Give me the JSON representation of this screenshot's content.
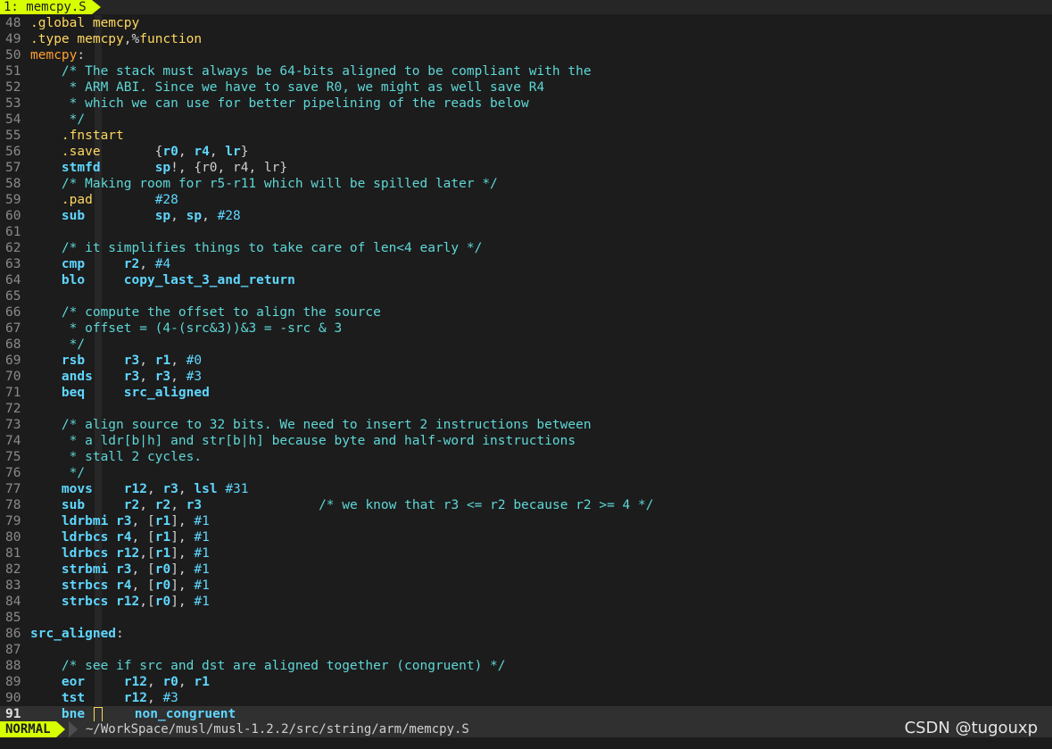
{
  "tabline": {
    "tab_label": "1: memcpy.S"
  },
  "statusline": {
    "mode": "NORMAL",
    "path": "~/WorkSpace/musl/musl-1.2.2/src/string/arm/memcpy.S"
  },
  "watermark": "CSDN @tugouxp",
  "colors": {
    "accent": "#d7ff00",
    "background": "#1c1c1c",
    "comment": "#5fd7d7",
    "label": "#ff9f2f",
    "keyword": "#5fd7ff",
    "directive": "#ffd75f"
  },
  "cursor_line": "91",
  "lines": [
    {
      "n": "48",
      "tokens": [
        [
          "directive",
          ".global "
        ],
        [
          "ident",
          "memcpy"
        ]
      ]
    },
    {
      "n": "49",
      "tokens": [
        [
          "directive",
          ".type "
        ],
        [
          "ident",
          "memcpy"
        ],
        [
          "plain",
          ",%"
        ],
        [
          "ident",
          "function"
        ]
      ]
    },
    {
      "n": "50",
      "tokens": [
        [
          "label",
          "memcpy"
        ],
        [
          "plain",
          ":"
        ]
      ]
    },
    {
      "n": "51",
      "tokens": [
        [
          "plain",
          "    "
        ],
        [
          "comment",
          "/* The stack must always be 64-bits aligned to be compliant with the"
        ]
      ]
    },
    {
      "n": "52",
      "tokens": [
        [
          "plain",
          "     "
        ],
        [
          "comment",
          "* ARM ABI. Since we have to save R0, we might as well save R4"
        ]
      ]
    },
    {
      "n": "53",
      "tokens": [
        [
          "plain",
          "     "
        ],
        [
          "comment",
          "* which we can use for better pipelining of the reads below"
        ]
      ]
    },
    {
      "n": "54",
      "tokens": [
        [
          "plain",
          "     "
        ],
        [
          "comment",
          "*/"
        ]
      ]
    },
    {
      "n": "55",
      "tokens": [
        [
          "plain",
          "    "
        ],
        [
          "directive",
          ".fnstart"
        ]
      ]
    },
    {
      "n": "56",
      "tokens": [
        [
          "plain",
          "    "
        ],
        [
          "directive",
          ".save"
        ],
        [
          "plain",
          "       {"
        ],
        [
          "reg",
          "r0"
        ],
        [
          "plain",
          ", "
        ],
        [
          "reg",
          "r4"
        ],
        [
          "plain",
          ", "
        ],
        [
          "reg",
          "lr"
        ],
        [
          "plain",
          "}"
        ]
      ]
    },
    {
      "n": "57",
      "tokens": [
        [
          "plain",
          "    "
        ],
        [
          "kw",
          "stmfd"
        ],
        [
          "plain",
          "       "
        ],
        [
          "reg",
          "sp"
        ],
        [
          "plain",
          "!, {r0, r4, lr}"
        ]
      ]
    },
    {
      "n": "58",
      "tokens": [
        [
          "plain",
          "    "
        ],
        [
          "comment",
          "/* Making room for r5-r11 which will be spilled later */"
        ]
      ]
    },
    {
      "n": "59",
      "tokens": [
        [
          "plain",
          "    "
        ],
        [
          "directive",
          ".pad"
        ],
        [
          "plain",
          "        "
        ],
        [
          "num",
          "#28"
        ]
      ]
    },
    {
      "n": "60",
      "tokens": [
        [
          "plain",
          "    "
        ],
        [
          "kw",
          "sub"
        ],
        [
          "plain",
          "         "
        ],
        [
          "reg",
          "sp"
        ],
        [
          "plain",
          ", "
        ],
        [
          "reg",
          "sp"
        ],
        [
          "plain",
          ", "
        ],
        [
          "num",
          "#28"
        ]
      ]
    },
    {
      "n": "61",
      "tokens": []
    },
    {
      "n": "62",
      "tokens": [
        [
          "plain",
          "    "
        ],
        [
          "comment",
          "/* it simplifies things to take care of len<4 early */"
        ]
      ]
    },
    {
      "n": "63",
      "tokens": [
        [
          "plain",
          "    "
        ],
        [
          "kw",
          "cmp"
        ],
        [
          "plain",
          "     "
        ],
        [
          "reg",
          "r2"
        ],
        [
          "plain",
          ", "
        ],
        [
          "num",
          "#4"
        ]
      ]
    },
    {
      "n": "64",
      "tokens": [
        [
          "plain",
          "    "
        ],
        [
          "kw",
          "blo"
        ],
        [
          "plain",
          "     "
        ],
        [
          "func",
          "copy_last_3_and_return"
        ]
      ]
    },
    {
      "n": "65",
      "tokens": []
    },
    {
      "n": "66",
      "tokens": [
        [
          "plain",
          "    "
        ],
        [
          "comment",
          "/* compute the offset to align the source"
        ]
      ]
    },
    {
      "n": "67",
      "tokens": [
        [
          "plain",
          "     "
        ],
        [
          "comment",
          "* offset = (4-(src&3))&3 = -src & 3"
        ]
      ]
    },
    {
      "n": "68",
      "tokens": [
        [
          "plain",
          "     "
        ],
        [
          "comment",
          "*/"
        ]
      ]
    },
    {
      "n": "69",
      "tokens": [
        [
          "plain",
          "    "
        ],
        [
          "kw",
          "rsb"
        ],
        [
          "plain",
          "     "
        ],
        [
          "reg",
          "r3"
        ],
        [
          "plain",
          ", "
        ],
        [
          "reg",
          "r1"
        ],
        [
          "plain",
          ", "
        ],
        [
          "num",
          "#0"
        ]
      ]
    },
    {
      "n": "70",
      "tokens": [
        [
          "plain",
          "    "
        ],
        [
          "kw",
          "ands"
        ],
        [
          "plain",
          "    "
        ],
        [
          "reg",
          "r3"
        ],
        [
          "plain",
          ", "
        ],
        [
          "reg",
          "r3"
        ],
        [
          "plain",
          ", "
        ],
        [
          "num",
          "#3"
        ]
      ]
    },
    {
      "n": "71",
      "tokens": [
        [
          "plain",
          "    "
        ],
        [
          "kw",
          "beq"
        ],
        [
          "plain",
          "     "
        ],
        [
          "func",
          "src_aligned"
        ]
      ]
    },
    {
      "n": "72",
      "tokens": []
    },
    {
      "n": "73",
      "tokens": [
        [
          "plain",
          "    "
        ],
        [
          "comment",
          "/* align source to 32 bits. We need to insert 2 instructions between"
        ]
      ]
    },
    {
      "n": "74",
      "tokens": [
        [
          "plain",
          "     "
        ],
        [
          "comment",
          "* a ldr[b|h] and str[b|h] because byte and half-word instructions"
        ]
      ]
    },
    {
      "n": "75",
      "tokens": [
        [
          "plain",
          "     "
        ],
        [
          "comment",
          "* stall 2 cycles."
        ]
      ]
    },
    {
      "n": "76",
      "tokens": [
        [
          "plain",
          "     "
        ],
        [
          "comment",
          "*/"
        ]
      ]
    },
    {
      "n": "77",
      "tokens": [
        [
          "plain",
          "    "
        ],
        [
          "kw",
          "movs"
        ],
        [
          "plain",
          "    "
        ],
        [
          "reg",
          "r12"
        ],
        [
          "plain",
          ", "
        ],
        [
          "reg",
          "r3"
        ],
        [
          "plain",
          ", "
        ],
        [
          "kw",
          "lsl"
        ],
        [
          "plain",
          " "
        ],
        [
          "num",
          "#31"
        ]
      ]
    },
    {
      "n": "78",
      "tokens": [
        [
          "plain",
          "    "
        ],
        [
          "kw",
          "sub"
        ],
        [
          "plain",
          "     "
        ],
        [
          "reg",
          "r2"
        ],
        [
          "plain",
          ", "
        ],
        [
          "reg",
          "r2"
        ],
        [
          "plain",
          ", "
        ],
        [
          "reg",
          "r3"
        ],
        [
          "plain",
          "               "
        ],
        [
          "comment",
          "/* we know that r3 <= r2 because r2 >= 4 */"
        ]
      ]
    },
    {
      "n": "79",
      "tokens": [
        [
          "plain",
          "    "
        ],
        [
          "kw",
          "ldrbmi"
        ],
        [
          "plain",
          " "
        ],
        [
          "reg",
          "r3"
        ],
        [
          "plain",
          ", ["
        ],
        [
          "reg",
          "r1"
        ],
        [
          "plain",
          "], "
        ],
        [
          "num",
          "#1"
        ]
      ]
    },
    {
      "n": "80",
      "tokens": [
        [
          "plain",
          "    "
        ],
        [
          "kw",
          "ldrbcs"
        ],
        [
          "plain",
          " "
        ],
        [
          "reg",
          "r4"
        ],
        [
          "plain",
          ", ["
        ],
        [
          "reg",
          "r1"
        ],
        [
          "plain",
          "], "
        ],
        [
          "num",
          "#1"
        ]
      ]
    },
    {
      "n": "81",
      "tokens": [
        [
          "plain",
          "    "
        ],
        [
          "kw",
          "ldrbcs"
        ],
        [
          "plain",
          " "
        ],
        [
          "reg",
          "r12"
        ],
        [
          "plain",
          ",["
        ],
        [
          "reg",
          "r1"
        ],
        [
          "plain",
          "], "
        ],
        [
          "num",
          "#1"
        ]
      ]
    },
    {
      "n": "82",
      "tokens": [
        [
          "plain",
          "    "
        ],
        [
          "kw",
          "strbmi"
        ],
        [
          "plain",
          " "
        ],
        [
          "reg",
          "r3"
        ],
        [
          "plain",
          ", ["
        ],
        [
          "reg",
          "r0"
        ],
        [
          "plain",
          "], "
        ],
        [
          "num",
          "#1"
        ]
      ]
    },
    {
      "n": "83",
      "tokens": [
        [
          "plain",
          "    "
        ],
        [
          "kw",
          "strbcs"
        ],
        [
          "plain",
          " "
        ],
        [
          "reg",
          "r4"
        ],
        [
          "plain",
          ", ["
        ],
        [
          "reg",
          "r0"
        ],
        [
          "plain",
          "], "
        ],
        [
          "num",
          "#1"
        ]
      ]
    },
    {
      "n": "84",
      "tokens": [
        [
          "plain",
          "    "
        ],
        [
          "kw",
          "strbcs"
        ],
        [
          "plain",
          " "
        ],
        [
          "reg",
          "r12"
        ],
        [
          "plain",
          ",["
        ],
        [
          "reg",
          "r0"
        ],
        [
          "plain",
          "], "
        ],
        [
          "num",
          "#1"
        ]
      ]
    },
    {
      "n": "85",
      "tokens": []
    },
    {
      "n": "86",
      "tokens": [
        [
          "func",
          "src_aligned"
        ],
        [
          "plain",
          ":"
        ]
      ]
    },
    {
      "n": "87",
      "tokens": []
    },
    {
      "n": "88",
      "tokens": [
        [
          "plain",
          "    "
        ],
        [
          "comment",
          "/* see if src and dst are aligned together (congruent) */"
        ]
      ]
    },
    {
      "n": "89",
      "tokens": [
        [
          "plain",
          "    "
        ],
        [
          "kw",
          "eor"
        ],
        [
          "plain",
          "     "
        ],
        [
          "reg",
          "r12"
        ],
        [
          "plain",
          ", "
        ],
        [
          "reg",
          "r0"
        ],
        [
          "plain",
          ", "
        ],
        [
          "reg",
          "r1"
        ]
      ]
    },
    {
      "n": "90",
      "tokens": [
        [
          "plain",
          "    "
        ],
        [
          "kw",
          "tst"
        ],
        [
          "plain",
          "     "
        ],
        [
          "reg",
          "r12"
        ],
        [
          "plain",
          ", "
        ],
        [
          "num",
          "#3"
        ]
      ]
    },
    {
      "n": "91",
      "tokens": [
        [
          "plain",
          "    "
        ],
        [
          "kw",
          "bne"
        ],
        [
          "plain",
          " "
        ],
        [
          "cursor",
          ""
        ],
        [
          "plain",
          "    "
        ],
        [
          "func",
          "non_congruent"
        ]
      ]
    }
  ]
}
